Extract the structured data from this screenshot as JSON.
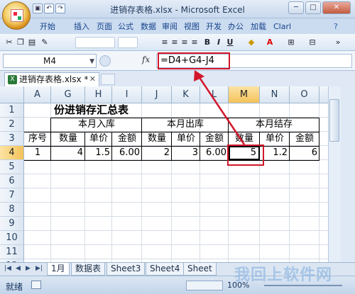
{
  "window": {
    "title": "进销存表格.xlsx - Microsoft Excel"
  },
  "ribbon_tabs": [
    "开始",
    "插入",
    "页面",
    "公式",
    "数据",
    "审阅",
    "视图",
    "开发",
    "办公",
    "加载",
    "Clarl"
  ],
  "name_box": {
    "value": "M4"
  },
  "formula": {
    "fx_label": "fx",
    "value": "=D4+G4-J4"
  },
  "workbook_tab": {
    "label": "进销存表格.xlsx *"
  },
  "columns": [
    "A",
    "G",
    "H",
    "I",
    "J",
    "K",
    "L",
    "M",
    "N",
    "O"
  ],
  "selected_column": "M",
  "rows": [
    "1",
    "2",
    "3",
    "4",
    "5",
    "6",
    "7",
    "8",
    "9",
    "10",
    "11",
    "12"
  ],
  "selected_row": "4",
  "sheet": {
    "title": "份进销存汇总表",
    "group_in": "本月入库",
    "group_out": "本月出库",
    "group_stock": "本月结存",
    "headers": [
      "序号",
      "数量",
      "单价",
      "金额",
      "数量",
      "单价",
      "金额",
      "数量",
      "单价",
      "金额"
    ],
    "row4": [
      "1",
      "4",
      "1.5",
      "6.00",
      "2",
      "3",
      "6.00",
      "5",
      "1.2",
      "6"
    ]
  },
  "sheet_tabs": [
    "1月",
    "数据表",
    "Sheet3",
    "Sheet4",
    "Sheet"
  ],
  "status": {
    "text": "就绪",
    "zoom": "100%"
  },
  "watermark": "我回上软件网",
  "colors": {
    "highlight": "#d2162b",
    "selection": "#f4c35a"
  }
}
